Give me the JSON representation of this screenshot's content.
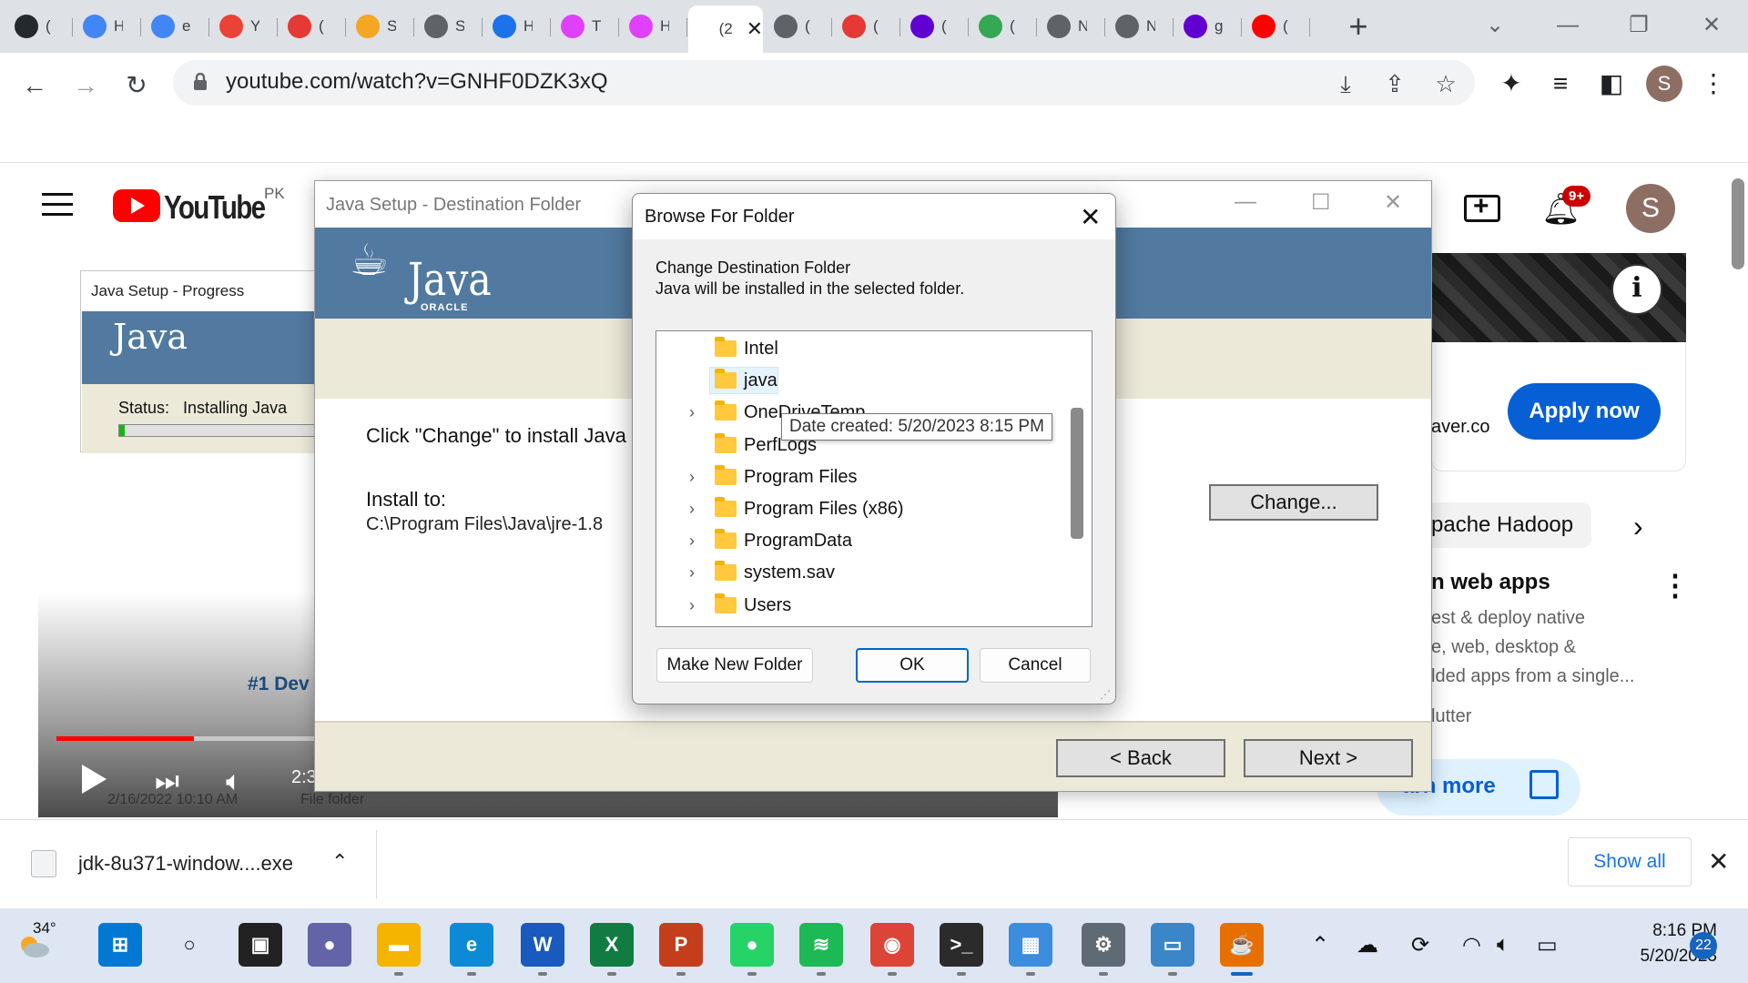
{
  "browser": {
    "tabs": [
      {
        "icon": "github-icon",
        "title": "(",
        "color": "#24292e"
      },
      {
        "icon": "google-icon",
        "title": "H",
        "color": "#4285f4"
      },
      {
        "icon": "google-icon",
        "title": "e",
        "color": "#4285f4"
      },
      {
        "icon": "gmail-icon",
        "title": "Y",
        "color": "#ea4335"
      },
      {
        "icon": "rounded-rect-icon",
        "title": "(",
        "color": "#e53935"
      },
      {
        "icon": "app-icon",
        "title": "S",
        "color": "#f5a623"
      },
      {
        "icon": "globe-icon",
        "title": "S",
        "color": "#5f6368"
      },
      {
        "icon": "history-icon",
        "title": "H",
        "color": "#1a73e8"
      },
      {
        "icon": "hexagon-icon",
        "title": "T",
        "color": "#e040fb"
      },
      {
        "icon": "hexagon-icon",
        "title": "H",
        "color": "#e040fb"
      },
      {
        "icon": "active-tab",
        "title": "(2",
        "color": "#ffffff"
      },
      {
        "icon": "globe-icon",
        "title": "(",
        "color": "#5f6368"
      },
      {
        "icon": "rounded-rect-icon",
        "title": "(",
        "color": "#e53935"
      },
      {
        "icon": "yahoo-icon",
        "title": "(",
        "color": "#6001d2"
      },
      {
        "icon": "chrome-icon",
        "title": "(",
        "color": "#34a853"
      },
      {
        "icon": "globe-icon",
        "title": "N",
        "color": "#5f6368"
      },
      {
        "icon": "globe-icon",
        "title": "N",
        "color": "#5f6368"
      },
      {
        "icon": "yahoo-icon",
        "title": "g",
        "color": "#6001d2"
      },
      {
        "icon": "youtube-icon",
        "title": "(",
        "color": "#ff0000"
      }
    ],
    "new_tab": "+",
    "url": "youtube.com/watch?v=GNHF0DZK3xQ",
    "profile_initial": "S"
  },
  "youtube": {
    "wordmark": "YouTube",
    "country": "PK",
    "notifications_badge": "9+",
    "avatar_initial": "S",
    "ad_domain": "aver.co",
    "apply_label": "Apply now",
    "chip_label": "pache Hadoop",
    "ad2_title": "n web apps",
    "ad2_lines": [
      "est & deploy native",
      "e, web, desktop &",
      "lded apps from a single..."
    ],
    "ad2_brand": "lutter",
    "learn_more": "arn more"
  },
  "video": {
    "time": "2:3",
    "date_text": "2/16/2022 10:10 AM",
    "type_text": "File folder",
    "dev_text": "#1 Dev",
    "progress_fraction": 0.14
  },
  "java_progress": {
    "title": "Java Setup - Progress",
    "logo": "Java",
    "status_label": "Status:",
    "status_value": "Installing Java"
  },
  "java_setup": {
    "title": "Java Setup - Destination Folder",
    "logo": "Java",
    "oracle": "ORACLE",
    "click_text": "Click \"Change\" to install Java",
    "install_label": "Install to:",
    "install_path": "C:\\Program Files\\Java\\jre-1.8",
    "change_label": "Change...",
    "back_label": "< Back",
    "next_label": "Next >"
  },
  "browse_dialog": {
    "title": "Browse For Folder",
    "heading": "Change Destination Folder",
    "subheading": "Java will be installed in the selected folder.",
    "tree": [
      {
        "label": "Intel",
        "expandable": false,
        "selected": false
      },
      {
        "label": "java",
        "expandable": false,
        "selected": true
      },
      {
        "label": "OneDriveTemp",
        "expandable": true,
        "selected": false
      },
      {
        "label": "PerfLogs",
        "expandable": false,
        "selected": false
      },
      {
        "label": "Program Files",
        "expandable": true,
        "selected": false
      },
      {
        "label": "Program Files (x86)",
        "expandable": true,
        "selected": false
      },
      {
        "label": "ProgramData",
        "expandable": true,
        "selected": false
      },
      {
        "label": "system.sav",
        "expandable": true,
        "selected": false
      },
      {
        "label": "Users",
        "expandable": true,
        "selected": false
      }
    ],
    "tooltip": "Date created: 5/20/2023 8:15 PM",
    "make_new_folder": "Make New Folder",
    "ok": "OK",
    "cancel": "Cancel"
  },
  "download_bar": {
    "filename": "jdk-8u371-window....exe",
    "show_all": "Show all"
  },
  "taskbar": {
    "temperature": "34°",
    "apps": [
      {
        "name": "start-icon",
        "glyph": "⊞",
        "color": "#0078d4"
      },
      {
        "name": "search-icon",
        "glyph": "○",
        "color": "#111111"
      },
      {
        "name": "task-view-icon",
        "glyph": "▣",
        "color": "#222222"
      },
      {
        "name": "teams-chat-icon",
        "glyph": "●",
        "color": "#6264a7"
      },
      {
        "name": "file-explorer-icon",
        "glyph": "▬",
        "color": "#f4b400"
      },
      {
        "name": "edge-icon",
        "glyph": "e",
        "color": "#0c8ad6"
      },
      {
        "name": "word-icon",
        "glyph": "W",
        "color": "#185abd"
      },
      {
        "name": "excel-icon",
        "glyph": "X",
        "color": "#107c41"
      },
      {
        "name": "powerpoint-icon",
        "glyph": "P",
        "color": "#c43e1c"
      },
      {
        "name": "whatsapp-icon",
        "glyph": "●",
        "color": "#25d366"
      },
      {
        "name": "spotify-icon",
        "glyph": "≋",
        "color": "#1db954"
      },
      {
        "name": "chrome-icon",
        "glyph": "◉",
        "color": "#db4437"
      },
      {
        "name": "terminal-icon",
        "glyph": ">_",
        "color": "#2b2b2b"
      },
      {
        "name": "control-panel-icon",
        "glyph": "▦",
        "color": "#3c8dde"
      },
      {
        "name": "settings-icon",
        "glyph": "⚙",
        "color": "#5f6a75"
      },
      {
        "name": "remote-desktop-icon",
        "glyph": "▭",
        "color": "#3a86c8"
      },
      {
        "name": "java-installer-icon",
        "glyph": "☕",
        "color": "#e76f00"
      }
    ],
    "time": "8:16 PM",
    "date": "5/20/2023",
    "notifications": "22"
  }
}
